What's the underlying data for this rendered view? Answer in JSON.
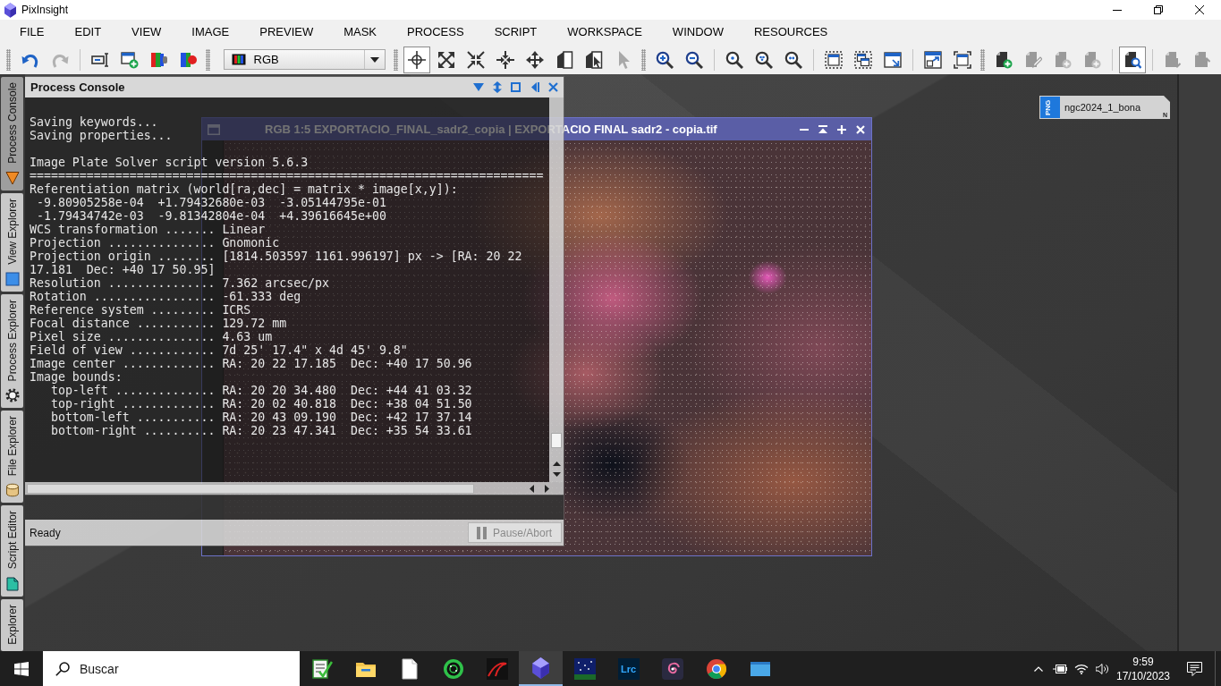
{
  "window": {
    "title": "PixInsight"
  },
  "menu": [
    "FILE",
    "EDIT",
    "VIEW",
    "IMAGE",
    "PREVIEW",
    "MASK",
    "PROCESS",
    "SCRIPT",
    "WORKSPACE",
    "WINDOW",
    "RESOURCES"
  ],
  "toolbars": [
    {
      "kind": "buttons",
      "sections": [
        [
          {
            "pressed": false,
            "disabled": false
          },
          {
            "pressed": false,
            "disabled": true
          }
        ],
        [
          {
            "pressed": false,
            "disabled": false
          },
          {
            "pressed": false,
            "disabled": false
          },
          {
            "pressed": false,
            "disabled": false
          },
          {
            "pressed": false,
            "disabled": false
          }
        ]
      ]
    },
    {
      "kind": "dropdown",
      "value": "RGB"
    },
    {
      "kind": "buttons",
      "sections": [
        [
          {
            "pressed": true,
            "disabled": false
          },
          {
            "pressed": false,
            "disabled": false
          },
          {
            "pressed": false,
            "disabled": false
          },
          {
            "pressed": false,
            "disabled": false
          },
          {
            "pressed": false,
            "disabled": false
          },
          {
            "pressed": false,
            "disabled": false
          },
          {
            "pressed": false,
            "disabled": false
          },
          {
            "pressed": false,
            "disabled": true
          }
        ]
      ]
    },
    {
      "kind": "buttons",
      "sections": [
        [
          {
            "pressed": false,
            "disabled": false
          },
          {
            "pressed": false,
            "disabled": false
          }
        ],
        [
          {
            "pressed": false,
            "disabled": false
          },
          {
            "pressed": false,
            "disabled": false
          },
          {
            "pressed": false,
            "disabled": false
          }
        ],
        [
          {
            "pressed": false,
            "disabled": false
          },
          {
            "pressed": false,
            "disabled": false
          },
          {
            "pressed": false,
            "disabled": false
          }
        ],
        [
          {
            "pressed": false,
            "disabled": false
          },
          {
            "pressed": false,
            "disabled": false
          }
        ]
      ]
    },
    {
      "kind": "buttons",
      "sections": [
        [
          {
            "pressed": false,
            "disabled": false
          },
          {
            "pressed": false,
            "disabled": true
          },
          {
            "pressed": false,
            "disabled": true
          },
          {
            "pressed": false,
            "disabled": true
          }
        ],
        [
          {
            "pressed": true,
            "disabled": false
          }
        ],
        [
          {
            "pressed": false,
            "disabled": true
          },
          {
            "pressed": false,
            "disabled": true
          }
        ]
      ]
    }
  ],
  "side_tabs": [
    {
      "label": "Process Console",
      "selected": true
    },
    {
      "label": "View Explorer",
      "selected": false
    },
    {
      "label": "Process Explorer",
      "selected": false
    },
    {
      "label": "File Explorer",
      "selected": false
    },
    {
      "label": "Script Editor",
      "selected": false
    },
    {
      "label": "Explorer",
      "selected": false
    }
  ],
  "console": {
    "title": "Process Console",
    "blocks": [
      [
        "Saving keywords...",
        "Saving properties..."
      ],
      [
        "Image Plate Solver script version 5.6.3",
        "========================================================================",
        "Referentiation matrix (world[ra,dec] = matrix * image[x,y]):",
        " -9.80905258e-04  +1.79432680e-03  -3.05144795e-01",
        " -1.79434742e-03  -9.81342804e-04  +4.39616645e+00",
        "WCS transformation ....... Linear",
        "Projection ............... Gnomonic",
        "Projection origin ........ [1814.503597 1161.996197] px -> [RA: 20 22",
        "17.181  Dec: +40 17 50.95]",
        "Resolution ............... 7.362 arcsec/px",
        "Rotation ................. -61.333 deg",
        "Reference system ......... ICRS",
        "Focal distance ........... 129.72 mm",
        "Pixel size ............... 4.63 um",
        "Field of view ............ 7d 25' 17.4\" x 4d 45' 9.8\"",
        "Image center ............. RA: 20 22 17.185  Dec: +40 17 50.96",
        "Image bounds:",
        "   top-left .............. RA: 20 20 34.480  Dec: +44 41 03.32",
        "   top-right ............. RA: 20 02 40.818  Dec: +38 04 51.50",
        "   bottom-left ........... RA: 20 43 09.190  Dec: +42 17 37.14",
        "   bottom-right .......... RA: 20 23 47.341  Dec: +35 54 33.61"
      ]
    ],
    "status": "Ready",
    "button": {
      "label": "Pause/Abort",
      "disabled": true
    }
  },
  "image_window": {
    "title": "RGB 1:5 EXPORTACIO_FINAL_sadr2_copia | EXPORTACIO FINAL sadr2 - copia.tif"
  },
  "image_icon": {
    "badge": "PNG",
    "label": "ngc2024_1_bona",
    "flag": "N"
  },
  "taskbar": {
    "search": {
      "placeholder": "Buscar"
    },
    "apps": [
      {
        "kind": "icon",
        "active": false
      },
      {
        "kind": "icon",
        "active": false
      },
      {
        "kind": "icon",
        "active": false
      },
      {
        "kind": "icon",
        "active": false
      },
      {
        "kind": "icon",
        "active": false
      },
      {
        "kind": "icon",
        "active": true
      },
      {
        "kind": "icon",
        "active": false
      },
      {
        "kind": "tile",
        "label": "Lrc",
        "active": false
      },
      {
        "kind": "icon",
        "active": false
      },
      {
        "kind": "icon",
        "active": false
      },
      {
        "kind": "icon",
        "active": false
      }
    ],
    "clock": {
      "time": "9:59",
      "date": "17/10/2023"
    }
  }
}
